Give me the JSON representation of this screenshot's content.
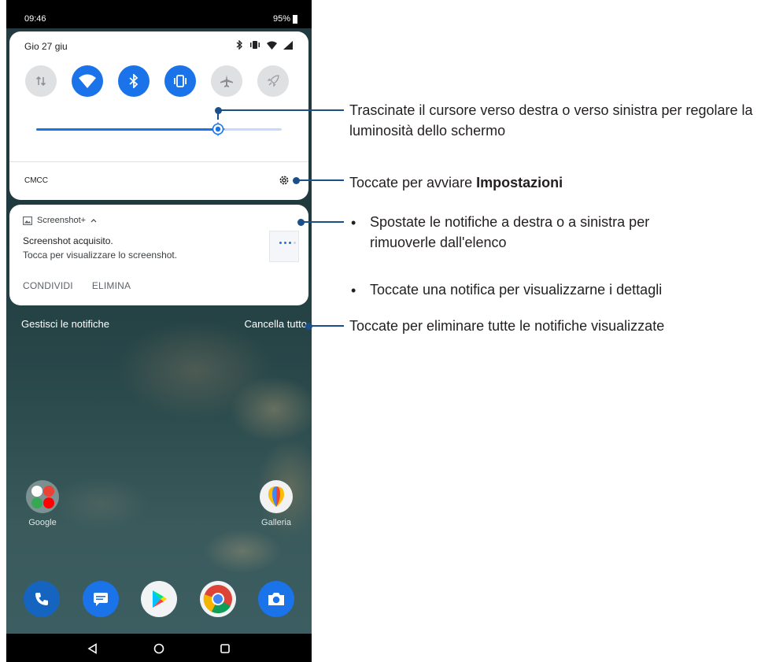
{
  "status_bar": {
    "time": "09:46",
    "battery": "95%"
  },
  "quick_settings": {
    "date": "Gio 27 giu",
    "carrier": "CMCC",
    "brightness_level": 0.74,
    "tiles": [
      {
        "icon": "mobile-data-icon",
        "on": false
      },
      {
        "icon": "wifi-icon",
        "on": true
      },
      {
        "icon": "bluetooth-icon",
        "on": true
      },
      {
        "icon": "vibrate-icon",
        "on": true
      },
      {
        "icon": "airplane-mode-icon",
        "on": false
      },
      {
        "icon": "game-genie-icon",
        "on": false
      }
    ]
  },
  "notification": {
    "app_name": "Screenshot+",
    "title": "Screenshot acquisito.",
    "body": "Tocca per visualizzare lo screenshot.",
    "actions": [
      "CONDIVIDI",
      "ELIMINA"
    ]
  },
  "shade_footer": {
    "manage": "Gestisci le notifiche",
    "clear_all": "Cancella tutto"
  },
  "home": {
    "apps": [
      {
        "label": "Google"
      },
      {
        "label": "Galleria"
      }
    ],
    "dock": [
      "phone-icon",
      "messages-icon",
      "play-store-icon",
      "chrome-icon",
      "camera-icon"
    ]
  },
  "callouts": {
    "brightness": "Trascinate il cursore verso destra o verso sinistra per regolare la luminosità dello schermo",
    "settings_prefix": "Toccate per avviare ",
    "settings_bold": "Impostazioni",
    "notif_bullet_1": "Spostate le notifiche a destra o a sinistra per rimuoverle dall'elenco",
    "notif_bullet_2": "Toccate una notifica per visualizzarne i dettagli",
    "clear_all": "Toccate per eliminare tutte le notifiche visualizzate"
  },
  "colors": {
    "accent": "#1a73e8",
    "callout": "#1b4f8a"
  }
}
